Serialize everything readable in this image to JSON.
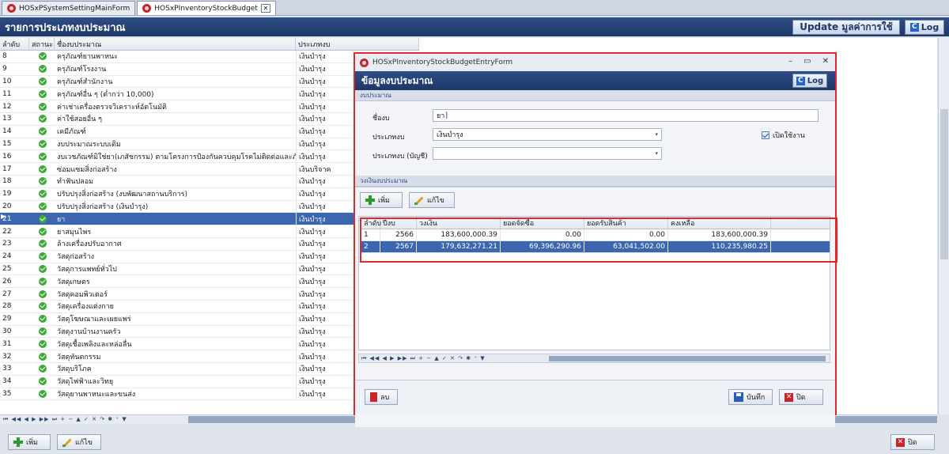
{
  "tabs": [
    {
      "label": "HOSxPSystemSettingMainForm"
    },
    {
      "label": "HOSxPInventoryStockBudget"
    }
  ],
  "header": {
    "title": "รายการประเภทงบประมาณ",
    "update_label": "Update มูลค่าการใช้",
    "log_label": "Log"
  },
  "grid": {
    "columns": [
      "ลำดับ",
      "สถานะ",
      "ชื่องบประมาณ",
      "ประเภทงบ"
    ],
    "rows": [
      {
        "no": "8",
        "name": "ครุภัณฑ์ยานพาหนะ",
        "type": "เงินบำรุง"
      },
      {
        "no": "9",
        "name": "ครุภัณฑ์โรงงาน",
        "type": "เงินบำรุง"
      },
      {
        "no": "10",
        "name": "ครุภัณฑ์สำนักงาน",
        "type": "เงินบำรุง"
      },
      {
        "no": "11",
        "name": "ครุภัณฑ์อื่น ๆ (ต่ำกว่า 10,000)",
        "type": "เงินบำรุง"
      },
      {
        "no": "12",
        "name": "ค่าเช่าเครื่องตรวจวิเคราะห์อัตโนมัติ",
        "type": "เงินบำรุง"
      },
      {
        "no": "13",
        "name": "ค่าใช้สอยอื่น ๆ",
        "type": "เงินบำรุง"
      },
      {
        "no": "14",
        "name": "เคมีภัณฑ์",
        "type": "เงินบำรุง"
      },
      {
        "no": "15",
        "name": "งบประมาณระบบเดิม",
        "type": "เงินบำรุง"
      },
      {
        "no": "16",
        "name": "งบเวชภัณฑ์มิใช่ยา(เภสัชกรรม) ตามโครงการป้องกันควบคุมโรคไม่ติดต่อและภัยสุขภาพ",
        "type": "เงินบำรุง"
      },
      {
        "no": "17",
        "name": "ซ่อมแซมสิ่งก่อสร้าง",
        "type": "เงินบริจาค"
      },
      {
        "no": "18",
        "name": "ทำฟันปลอม",
        "type": "เงินบำรุง"
      },
      {
        "no": "19",
        "name": "ปรับปรุงสิ่งก่อสร้าง (งบพัฒนาสถานบริการ)",
        "type": "เงินบำรุง"
      },
      {
        "no": "20",
        "name": "ปรับปรุงสิ่งก่อสร้าง (เงินบำรุง)",
        "type": "เงินบำรุง"
      },
      {
        "no": "21",
        "name": "ยา",
        "type": "เงินบำรุง"
      },
      {
        "no": "22",
        "name": "ยาสมุนไพร",
        "type": "เงินบำรุง"
      },
      {
        "no": "23",
        "name": "ล้างเครื่องปรับอากาศ",
        "type": "เงินบำรุง"
      },
      {
        "no": "24",
        "name": "วัสดุก่อสร้าง",
        "type": "เงินบำรุง"
      },
      {
        "no": "25",
        "name": "วัสดุการแพทย์ทั่วไป",
        "type": "เงินบำรุง"
      },
      {
        "no": "26",
        "name": "วัสดุเกษตร",
        "type": "เงินบำรุง"
      },
      {
        "no": "27",
        "name": "วัสดุคอมพิวเตอร์",
        "type": "เงินบำรุง"
      },
      {
        "no": "28",
        "name": "วัสดุเครื่องแต่งกาย",
        "type": "เงินบำรุง"
      },
      {
        "no": "29",
        "name": "วัสดุโฆษณาและเผยแพร่",
        "type": "เงินบำรุง"
      },
      {
        "no": "30",
        "name": "วัสดุงานบ้านงานครัว",
        "type": "เงินบำรุง"
      },
      {
        "no": "31",
        "name": "วัสดุเชื้อเพลิงและหล่อลื่น",
        "type": "เงินบำรุง"
      },
      {
        "no": "32",
        "name": "วัสดุทันตกรรม",
        "type": "เงินบำรุง"
      },
      {
        "no": "33",
        "name": "วัสดุบริโภค",
        "type": "เงินบำรุง"
      },
      {
        "no": "34",
        "name": "วัสดุไฟฟ้าและวิทยุ",
        "type": "เงินบำรุง"
      },
      {
        "no": "35",
        "name": "วัสดุยานพาหนะและขนส่ง",
        "type": "เงินบำรุง"
      }
    ],
    "selected_no": "21",
    "nav_glyphs": "⏮ ◀◀ ◀ ▶ ▶▶ ⏭ + − ▲ ✓ ✕ ↷ ✱ ⁺ ▼"
  },
  "bottom": {
    "add_label": "เพิ่ม",
    "edit_label": "แก้ไข",
    "close_label": "ปิด"
  },
  "dialog": {
    "window_title": "HOSxPInventoryStockBudgetEntryForm",
    "header_title": "ข้อมูลงบประมาณ",
    "log_label": "Log",
    "section_budget": "งบประมาณ",
    "name_label": "ชื่องบ",
    "name_value": "ยา",
    "type_label": "ประเภทงบ",
    "type_value": "เงินบำรุง",
    "account_type_label": "ประเภทงบ (บัญชี)",
    "account_type_value": "",
    "active_label": "เปิดใช้งาน",
    "section_amount": "วงเงินงบประมาณ",
    "add_label": "เพิ่ม",
    "edit_label": "แก้ไข",
    "subgrid": {
      "columns": [
        "ลำดับ",
        "ปีงบ",
        "วงเงิน",
        "ยอดจัดซื้อ",
        "ยอดรับสินค้า",
        "คงเหลือ"
      ],
      "rows": [
        {
          "no": "1",
          "year": "2566",
          "amount": "183,600,000.39",
          "purchase": "0.00",
          "received": "0.00",
          "remaining": "183,600,000.39"
        },
        {
          "no": "2",
          "year": "2567",
          "amount": "179,632,271.21",
          "purchase": "69,396,290.96",
          "received": "63,041,502.00",
          "remaining": "110,235,980.25"
        }
      ]
    },
    "delete_label": "ลบ",
    "save_label": "บันทึก",
    "close_label": "ปิด"
  },
  "colors": {
    "header_bg": "#1e3866",
    "selection": "#3d66b1",
    "highlight_frame": "#e3262b",
    "status_ok": "#3faa3a"
  }
}
